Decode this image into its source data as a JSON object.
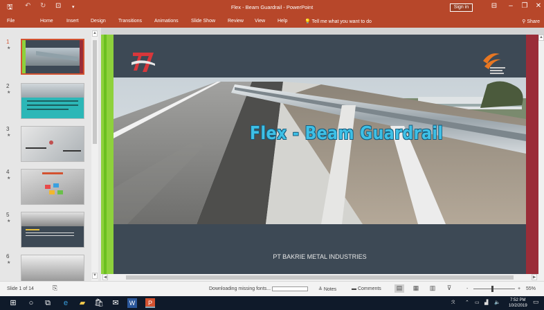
{
  "window": {
    "title": "Flex - Beam Guardrail  -  PowerPoint",
    "sign_in": "Sign in"
  },
  "menu": {
    "tabs": [
      "File",
      "Home",
      "Insert",
      "Design",
      "Transitions",
      "Animations",
      "Slide Show",
      "Review",
      "View",
      "Help"
    ],
    "tell_me": "Tell me what you want to do",
    "share": "Share"
  },
  "thumbnails": {
    "numbers": [
      "1",
      "2",
      "3",
      "4",
      "5",
      "6"
    ],
    "star": "★",
    "selected": "1"
  },
  "slide": {
    "headline": "Flex - Beam Guardrail",
    "company": "PT BAKRIE METAL INDUSTRIES",
    "logo_text": "77",
    "colors": {
      "dark_bg": "#3d4955",
      "lime": "#8ed13c",
      "red_bar": "#9a2d38",
      "headline": "#3ec0e6"
    }
  },
  "status": {
    "slide_counter": "Slide 1 of 14",
    "downloading": "Downloading missing fonts...",
    "notes": "Notes",
    "comments": "Comments",
    "zoom_minus": "-",
    "zoom_plus": "+",
    "zoom": "55%"
  },
  "taskbar": {
    "time": "7:52 PM",
    "date": "10/2/2019"
  }
}
